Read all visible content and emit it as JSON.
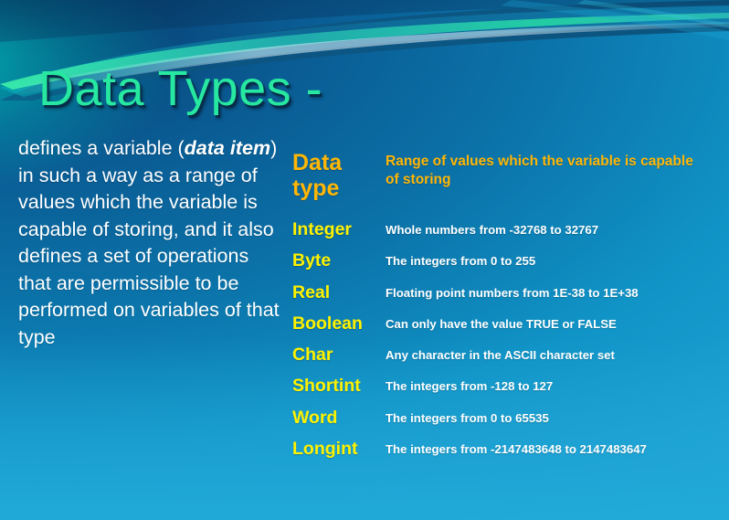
{
  "slide": {
    "title": "Data Types -",
    "title_color": "#27e8a0",
    "background_colors": {
      "top_dark": "#063a6b",
      "mid": "#0c78ae",
      "bottom_light": "#21a6d8",
      "teal_accent": "#00beb9"
    }
  },
  "body": {
    "part1": "defines a variable (",
    "emphasis": "data item",
    "part2": ") in such a way as a range of values which the variable is capable of storing, and it also defines a set of operations that are permissible to be performed on variables of that type"
  },
  "table": {
    "header_color": "#ffb606",
    "name_color": "#fff200",
    "desc_color": "#ffffff",
    "headers": {
      "type": "Data type",
      "range": "Range of values which the variable is capable of storing"
    },
    "rows": [
      {
        "name": "Integer",
        "desc": "Whole numbers from -32768 to 32767"
      },
      {
        "name": "Byte",
        "desc": "The integers from 0 to 255"
      },
      {
        "name": "Real",
        "desc": "Floating point numbers from 1E-38 to 1E+38"
      },
      {
        "name": "Boolean",
        "desc": "Can only have the value TRUE or FALSE"
      },
      {
        "name": "Char",
        "desc": "Any character in the ASCII character set"
      },
      {
        "name": "Shortint",
        "desc": "The integers from -128 to 127"
      },
      {
        "name": "Word",
        "desc": "The integers from 0 to 65535"
      },
      {
        "name": "Longint",
        "desc": "The integers from -2147483648 to 2147483647"
      }
    ]
  }
}
